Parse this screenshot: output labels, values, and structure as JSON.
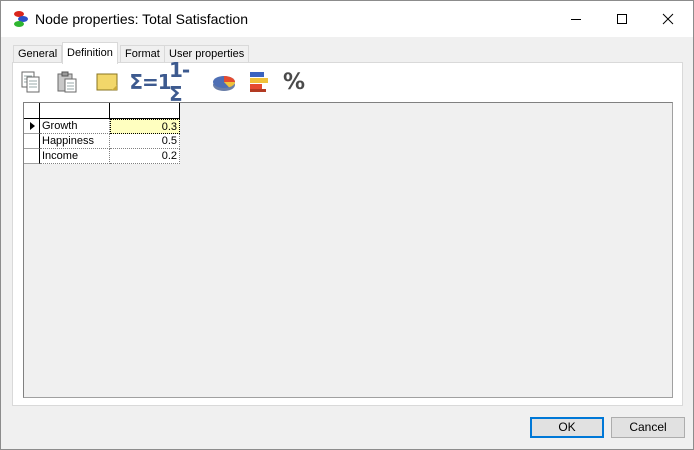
{
  "window": {
    "title": "Node properties: Total Satisfaction"
  },
  "tabs": [
    {
      "label": "General"
    },
    {
      "label": "Definition",
      "active": true
    },
    {
      "label": "Format"
    },
    {
      "label": "User properties"
    }
  ],
  "toolbar": {
    "icons": [
      "copy-icon",
      "paste-icon",
      "note-icon",
      "sum-to-one-icon",
      "complement-icon",
      "pie-chart-icon",
      "bar-chart-icon",
      "percent-icon"
    ],
    "sum_to_one_label": "Σ=1",
    "complement_label": "1-Σ",
    "percent_label": "%"
  },
  "grid": {
    "rows": [
      {
        "name": "Growth",
        "value": "0.3",
        "selected": true
      },
      {
        "name": "Happiness",
        "value": "0.5"
      },
      {
        "name": "Income",
        "value": "0.2"
      }
    ]
  },
  "buttons": {
    "ok": "OK",
    "cancel": "Cancel"
  },
  "colors": {
    "selected_cell": "#ffffc0",
    "ok_border": "#0078d7"
  }
}
